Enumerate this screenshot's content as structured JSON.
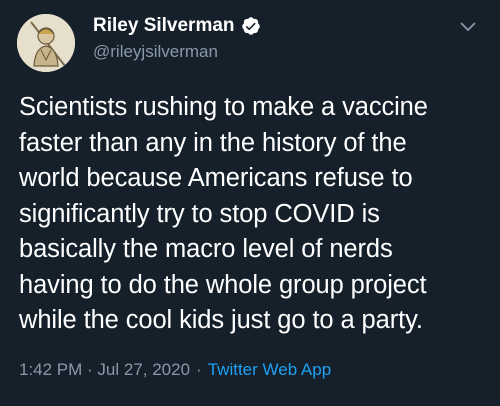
{
  "tweet": {
    "author_name": "Riley Silverman",
    "author_handle": "@rileyjsilverman",
    "verified_icon": "verified-badge-icon",
    "body": "Scientists rushing to make a vaccine\nfaster than any in the history of the\nworld because Americans refuse to\nsignificantly try to stop COVID is\nbasically the macro level of nerds\nhaving to do the whole group project\nwhile the cool kids just go to a party.",
    "timestamp": "1:42 PM · Jul 27, 2020",
    "separator": "·",
    "source": "Twitter Web App"
  },
  "colors": {
    "background": "#15202b",
    "text": "#ffffff",
    "muted": "#8899a6",
    "link": "#1da1f2",
    "verified": "#ffffff"
  }
}
